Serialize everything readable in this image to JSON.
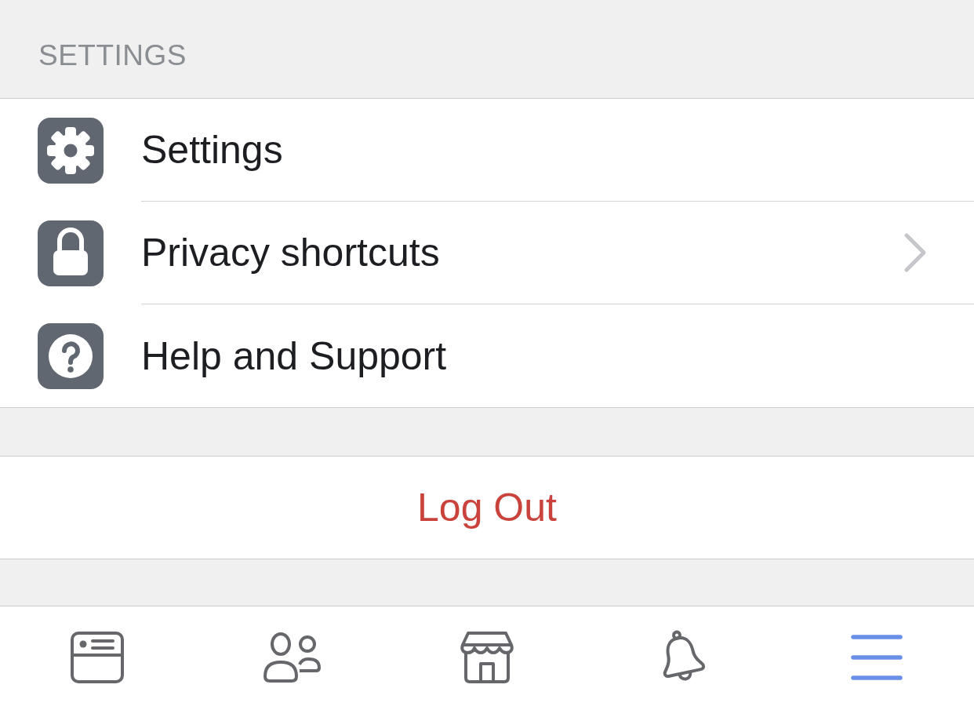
{
  "section_header": "SETTINGS",
  "settings_items": [
    {
      "label": "Settings",
      "chevron": false
    },
    {
      "label": "Privacy shortcuts",
      "chevron": true
    },
    {
      "label": "Help and Support",
      "chevron": false
    }
  ],
  "logout_button": "Log Out",
  "tab_bar": [
    {
      "selected": false
    },
    {
      "selected": false
    },
    {
      "selected": false
    },
    {
      "selected": false
    },
    {
      "selected": true
    }
  ]
}
